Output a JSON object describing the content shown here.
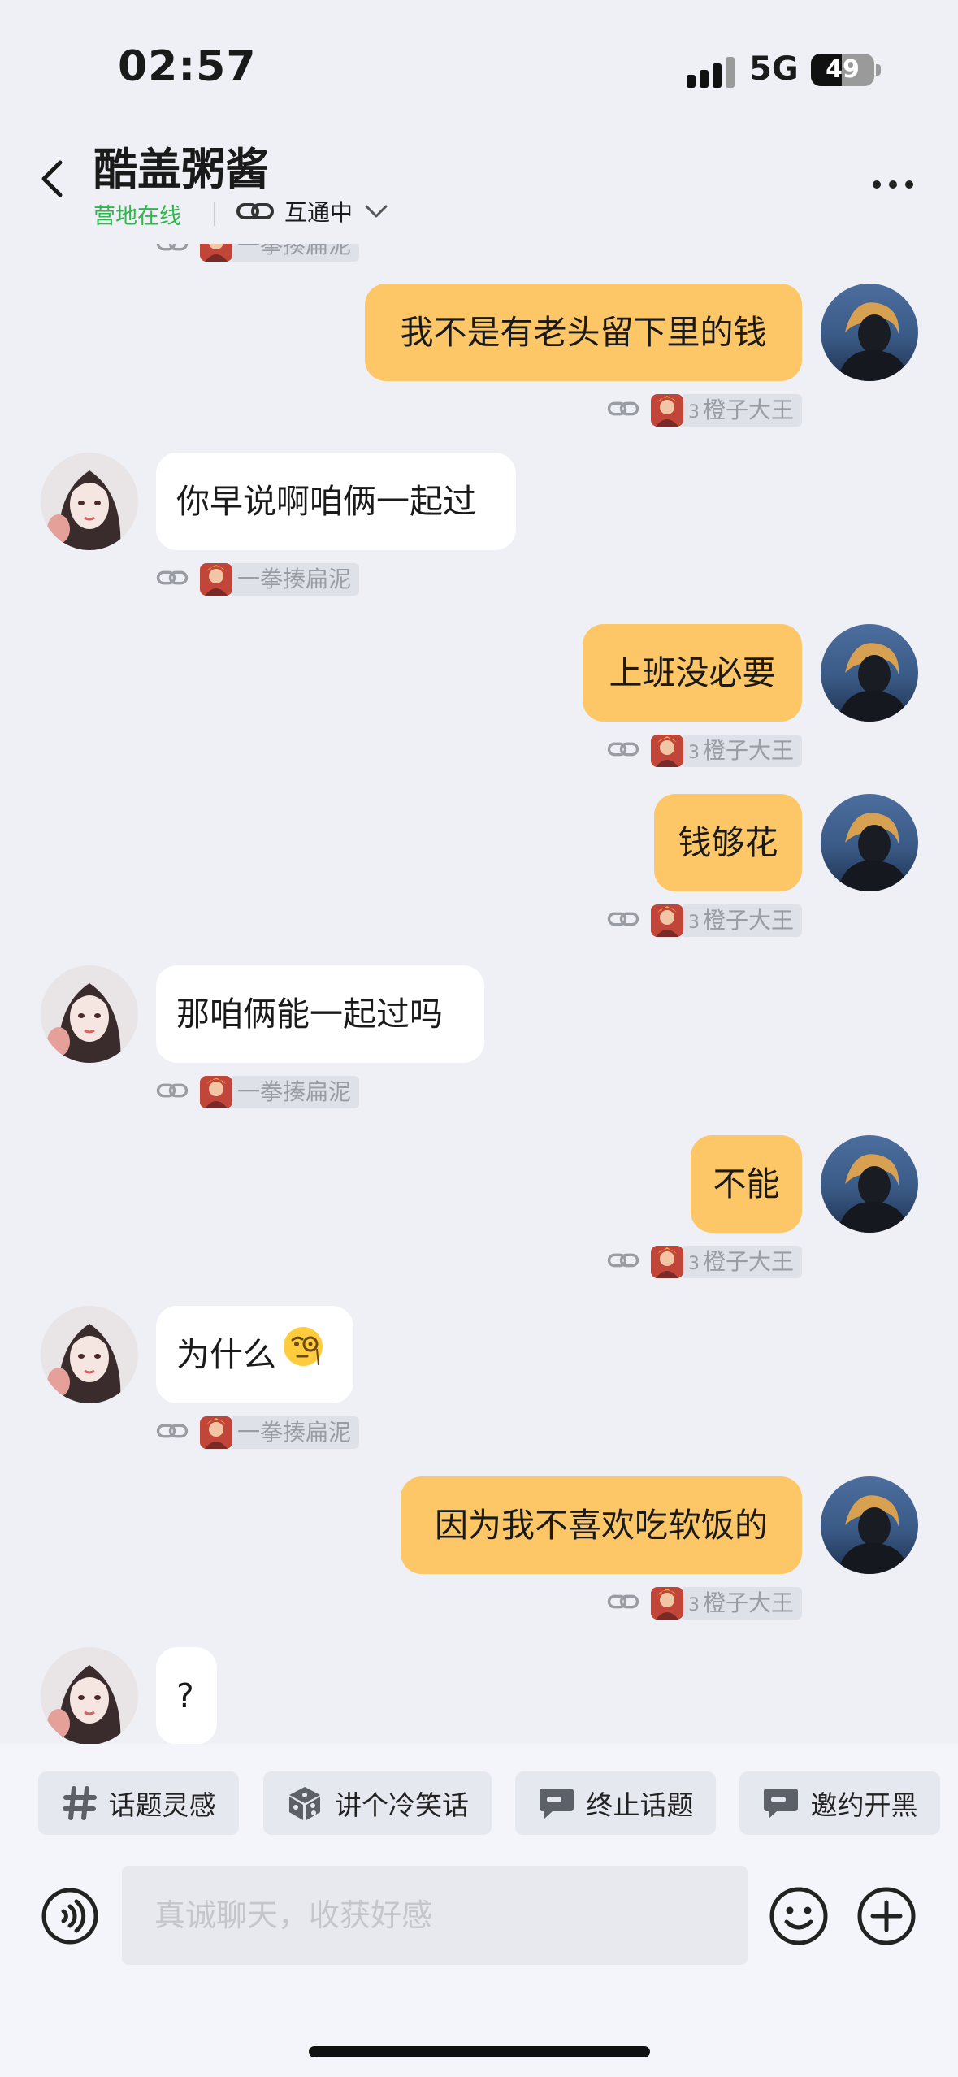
{
  "status_bar": {
    "time": "02:57",
    "network": "5G",
    "battery_level": "49",
    "battery_fraction": 0.49
  },
  "header": {
    "contact_name": "酷盖粥酱",
    "online_status": "营地在线",
    "mutual_status": "互通中",
    "icons": {
      "back": "chevron-left-icon",
      "link": "link-icon",
      "dropdown": "chevron-down-icon",
      "more": "more-icon"
    }
  },
  "my_tag": {
    "level": "3",
    "name": "橙子大王"
  },
  "their_tag": {
    "name": "一拳揍扁泥"
  },
  "messages": [
    {
      "from": "me",
      "text": "我不是有老头留下里的钱"
    },
    {
      "from": "them",
      "text": "你早说啊咱俩一起过"
    },
    {
      "from": "me",
      "text": "上班没必要"
    },
    {
      "from": "me",
      "text": "钱够花"
    },
    {
      "from": "them",
      "text": "那咱俩能一起过吗"
    },
    {
      "from": "me",
      "text": "不能"
    },
    {
      "from": "them",
      "text": "为什么",
      "emoji": "monocle-face-emoji"
    },
    {
      "from": "me",
      "text": "因为我不喜欢吃软饭的"
    },
    {
      "from": "them",
      "text": "?"
    }
  ],
  "quick_actions": [
    {
      "label": "话题灵感",
      "icon": "hashtag-icon"
    },
    {
      "label": "讲个冷笑话",
      "icon": "dice-icon"
    },
    {
      "label": "终止话题",
      "icon": "chat-bubble-icon"
    },
    {
      "label": "邀约开黑",
      "icon": "chat-bubble-icon"
    }
  ],
  "input": {
    "placeholder": "真诚聊天，收获好感"
  },
  "colors": {
    "accent_online": "#2fb84a",
    "my_bubble": "#fdc768",
    "their_bubble": "#ffffff",
    "background": "#eef0f6"
  }
}
